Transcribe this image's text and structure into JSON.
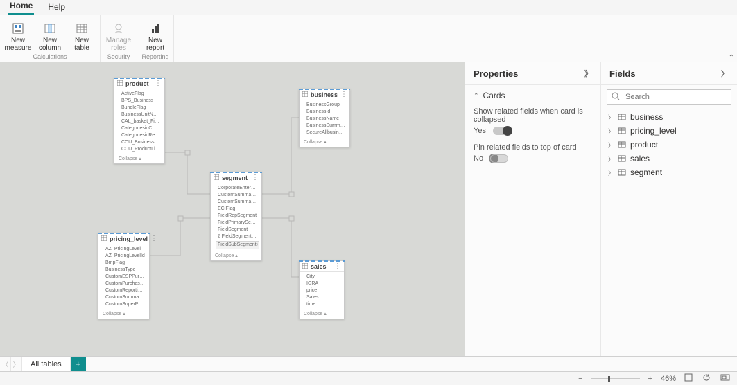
{
  "menu": {
    "home": "Home",
    "help": "Help"
  },
  "ribbon": {
    "calculations": {
      "label": "Calculations",
      "new_measure": "New\nmeasure",
      "new_column": "New\ncolumn",
      "new_table": "New\ntable"
    },
    "security": {
      "label": "Security",
      "manage_roles": "Manage\nroles"
    },
    "reporting": {
      "label": "Reporting",
      "new_report": "New\nreport"
    }
  },
  "tabs": {
    "all_tables": "All tables"
  },
  "properties": {
    "title": "Properties",
    "cards_section": "Cards",
    "show_related": "Show related fields when card is collapsed",
    "show_related_state": "Yes",
    "pin_related": "Pin related fields to top of card",
    "pin_related_state": "No"
  },
  "fields_panel": {
    "title": "Fields",
    "search_placeholder": "Search",
    "tables": [
      "business",
      "pricing_level",
      "product",
      "sales",
      "segment"
    ]
  },
  "cards": {
    "product": {
      "title": "product",
      "fields": [
        "ActiveFlag",
        "BPS_Business",
        "BundleFlag",
        "BusinessUnitName",
        "CAL_basket_Files",
        "CategoriesinCRMField",
        "CategoriesinRetail",
        "CCU_BusinessUnit",
        "CCU_ProductLicensesAndServices"
      ],
      "collapse": "Collapse"
    },
    "business": {
      "title": "business",
      "fields": [
        "BusinessGroup",
        "BusinessId",
        "BusinessName",
        "BusinessSummaryName",
        "SecureAllbusiness"
      ],
      "collapse": "Collapse"
    },
    "segment": {
      "title": "segment",
      "fields": [
        "CorporateEnterpriseFlag",
        "CustomSummarySector",
        "CustomSummarySegment",
        "ECIFlag",
        "FieldRepSegment",
        "FieldPrimarySegment",
        "FieldSegment",
        "FieldSegmentType",
        "FieldSubSegment"
      ],
      "collapse": "Collapse"
    },
    "pricing_level": {
      "title": "pricing_level",
      "fields": [
        "AZ_PricingLevel",
        "AZ_PricingLevelId",
        "BmpFlag",
        "BusinessType",
        "CustomESPPurchaseType",
        "CustomPurchaseType",
        "CustomReportingSummaryPurc...",
        "CustomSummaryPurchaseType",
        "CustomSuperPricingLevel"
      ],
      "collapse": "Collapse"
    },
    "sales": {
      "title": "sales",
      "fields": [
        "City",
        "IGRA",
        "price",
        "Sales",
        "time"
      ],
      "collapse": "Collapse"
    }
  },
  "status": {
    "zoom": "46%"
  }
}
